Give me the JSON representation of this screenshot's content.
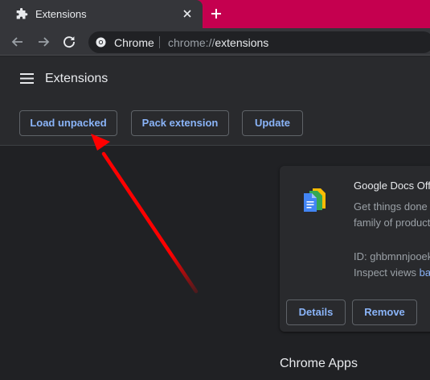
{
  "tab": {
    "title": "Extensions",
    "favicon": "puzzle-icon",
    "close_icon": "close-icon"
  },
  "new_tab_icon": "plus-icon",
  "toolbar": {
    "back_icon": "arrow-left-icon",
    "forward_icon": "arrow-right-icon",
    "reload_icon": "reload-icon",
    "chip_label": "Chrome",
    "url_prefix": "chrome://",
    "url_host": "extensions"
  },
  "header": {
    "title": "Extensions",
    "menu_icon": "hamburger-menu-icon"
  },
  "dev_toolbar": {
    "load_unpacked": "Load unpacked",
    "pack_extension": "Pack extension",
    "update": "Update"
  },
  "extension_card": {
    "name": "Google Docs Off",
    "description_line1": "Get things done",
    "description_line2": "family of product",
    "id_text": "ID: ghbmnnjooek",
    "inspect_label": "Inspect views",
    "inspect_link": "ba",
    "details_button": "Details",
    "remove_button": "Remove"
  },
  "section_title": "Chrome Apps",
  "annotation": {
    "type": "arrow",
    "color": "#ff0000",
    "points_to": "load-unpacked-button"
  },
  "colors": {
    "tab_strip": "#c5004f",
    "surface": "#35363a",
    "page_bg": "#202124",
    "card_bg": "#292a2d",
    "accent": "#8ab4f8",
    "arrow": "#ff0000"
  }
}
